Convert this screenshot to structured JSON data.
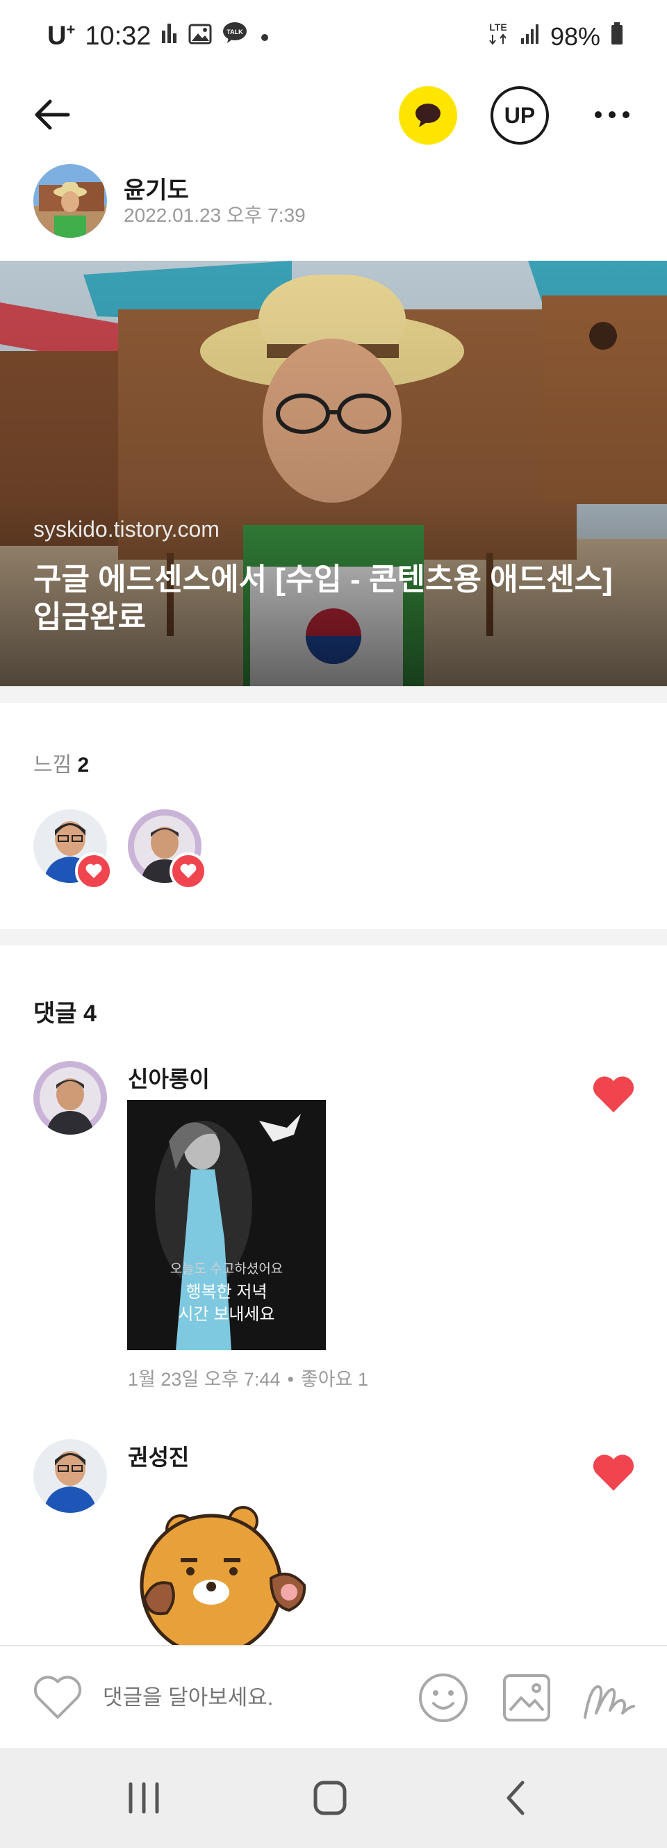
{
  "status_bar": {
    "carrier": "U",
    "carrier_sup": "+",
    "time": "10:32",
    "network": "LTE",
    "battery": "98%"
  },
  "app_bar": {
    "up_label": "UP"
  },
  "post": {
    "author_name": "윤기도",
    "date": "2022.01.23 오후 7:39",
    "link_domain": "syskido.tistory.com",
    "link_title": "구글 에드센스에서 [수입 - 콘텐츠용 애드센스] 입금완료"
  },
  "feelings": {
    "label": "느낌",
    "count": "2"
  },
  "comments": {
    "label": "댓글",
    "count": "4",
    "items": [
      {
        "name": "신아롱이",
        "image_text": [
          "오늘도 수고하셨어요",
          "행복한 저녁",
          "시간 보내세요"
        ],
        "time": "1월 23일 오후 7:44",
        "likes": "좋아요 1"
      },
      {
        "name": "권성진"
      }
    ]
  },
  "input": {
    "placeholder": "댓글을 달아보세요."
  },
  "colors": {
    "kakao_yellow": "#fee500",
    "like_red": "#f0454e",
    "muted_text": "#9a9a9a"
  }
}
